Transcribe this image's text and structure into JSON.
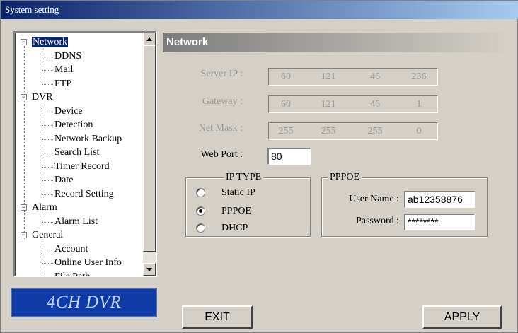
{
  "window": {
    "title": "System setting"
  },
  "tree": {
    "items": [
      {
        "label": "Network",
        "level": 0,
        "expander": "−",
        "selected": true
      },
      {
        "label": "DDNS",
        "level": 1
      },
      {
        "label": "Mail",
        "level": 1
      },
      {
        "label": "FTP",
        "level": 1
      },
      {
        "label": "DVR",
        "level": 0,
        "expander": "−"
      },
      {
        "label": "Device",
        "level": 1
      },
      {
        "label": "Detection",
        "level": 1
      },
      {
        "label": "Network Backup",
        "level": 1
      },
      {
        "label": "Search List",
        "level": 1
      },
      {
        "label": "Timer Record",
        "level": 1
      },
      {
        "label": "Date",
        "level": 1
      },
      {
        "label": "Record Setting",
        "level": 1
      },
      {
        "label": "Alarm",
        "level": 0,
        "expander": "−"
      },
      {
        "label": "Alarm List",
        "level": 1
      },
      {
        "label": "General",
        "level": 0,
        "expander": "−"
      },
      {
        "label": "Account",
        "level": 1
      },
      {
        "label": "Online User Info",
        "level": 1
      },
      {
        "label": "File Path",
        "level": 1
      }
    ]
  },
  "logo": {
    "text": "4CH DVR"
  },
  "section": {
    "title": "Network"
  },
  "network": {
    "server_ip": {
      "label": "Server IP :",
      "octets": [
        "60",
        "121",
        "46",
        "236"
      ]
    },
    "gateway": {
      "label": "Gateway :",
      "octets": [
        "60",
        "121",
        "46",
        "1"
      ]
    },
    "netmask": {
      "label": "Net Mask :",
      "octets": [
        "255",
        "255",
        "255",
        "0"
      ]
    },
    "web_port": {
      "label": "Web Port :",
      "value": "80"
    }
  },
  "ip_type": {
    "title": "IP TYPE",
    "options": [
      {
        "label": "Static IP",
        "checked": false
      },
      {
        "label": "PPPOE",
        "checked": true
      },
      {
        "label": "DHCP",
        "checked": false
      }
    ]
  },
  "pppoe": {
    "title": "PPPOE",
    "username_label": "User Name :",
    "username_value": "ab12358876",
    "password_label": "Password :",
    "password_value": "********"
  },
  "buttons": {
    "exit": "EXIT",
    "apply": "APPLY"
  }
}
